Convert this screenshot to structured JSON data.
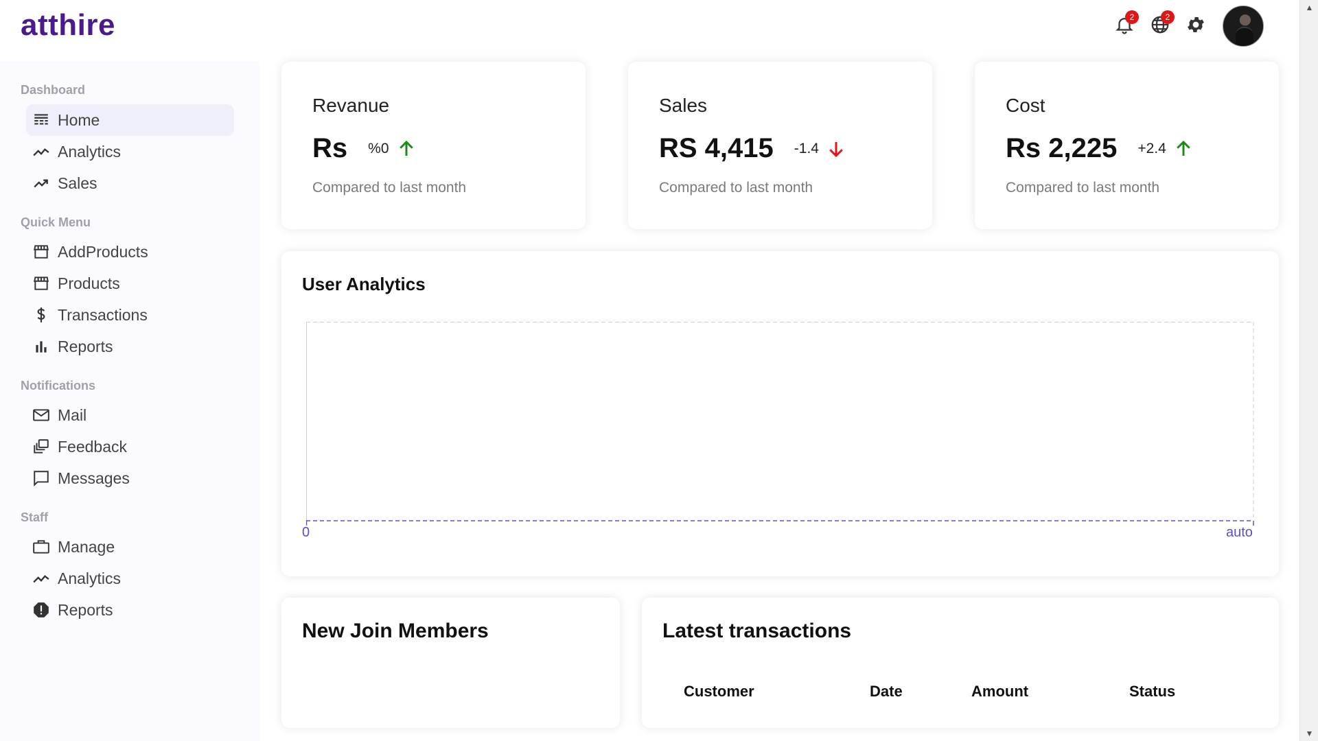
{
  "app": {
    "logo": "atthire"
  },
  "header": {
    "notifications_badge": "2",
    "language_badge": "2"
  },
  "sidebar": {
    "sections": [
      {
        "title": "Dashboard",
        "items": [
          {
            "label": "Home",
            "icon": "home-dashboard-icon",
            "active": true
          },
          {
            "label": "Analytics",
            "icon": "timeline-icon"
          },
          {
            "label": "Sales",
            "icon": "trending-up-icon"
          }
        ]
      },
      {
        "title": "Quick Menu",
        "items": [
          {
            "label": "AddProducts",
            "icon": "storefront-icon"
          },
          {
            "label": "Products",
            "icon": "storefront-icon"
          },
          {
            "label": "Transactions",
            "icon": "dollar-icon"
          },
          {
            "label": "Reports",
            "icon": "bar-chart-icon"
          }
        ]
      },
      {
        "title": "Notifications",
        "items": [
          {
            "label": "Mail",
            "icon": "mail-icon"
          },
          {
            "label": "Feedback",
            "icon": "dynamic-feed-icon"
          },
          {
            "label": "Messages",
            "icon": "chat-bubble-icon"
          }
        ]
      },
      {
        "title": "Staff",
        "items": [
          {
            "label": "Manage",
            "icon": "work-briefcase-icon"
          },
          {
            "label": "Analytics",
            "icon": "timeline-icon"
          },
          {
            "label": "Reports",
            "icon": "report-icon"
          }
        ]
      }
    ]
  },
  "stats": [
    {
      "title": "Revanue",
      "value": "Rs",
      "delta": "%0",
      "trend": "up",
      "subtitle": "Compared to last month"
    },
    {
      "title": "Sales",
      "value": "RS 4,415",
      "delta": "-1.4",
      "trend": "down",
      "subtitle": "Compared to last month"
    },
    {
      "title": "Cost",
      "value": "Rs 2,225",
      "delta": "+2.4",
      "trend": "up",
      "subtitle": "Compared to last month"
    }
  ],
  "colors": {
    "up": "#1a8a1a",
    "down": "#e01616",
    "accent": "#4a1b8a",
    "axis": "#5b4fc9"
  },
  "chart_data": {
    "type": "line",
    "title": "User Analytics",
    "x_ticks": [
      "0",
      "auto"
    ],
    "series": [],
    "grid": true
  },
  "members": {
    "title": "New Join Members"
  },
  "transactions": {
    "title": "Latest transactions",
    "columns": [
      "Customer",
      "Date",
      "Amount",
      "Status"
    ]
  }
}
